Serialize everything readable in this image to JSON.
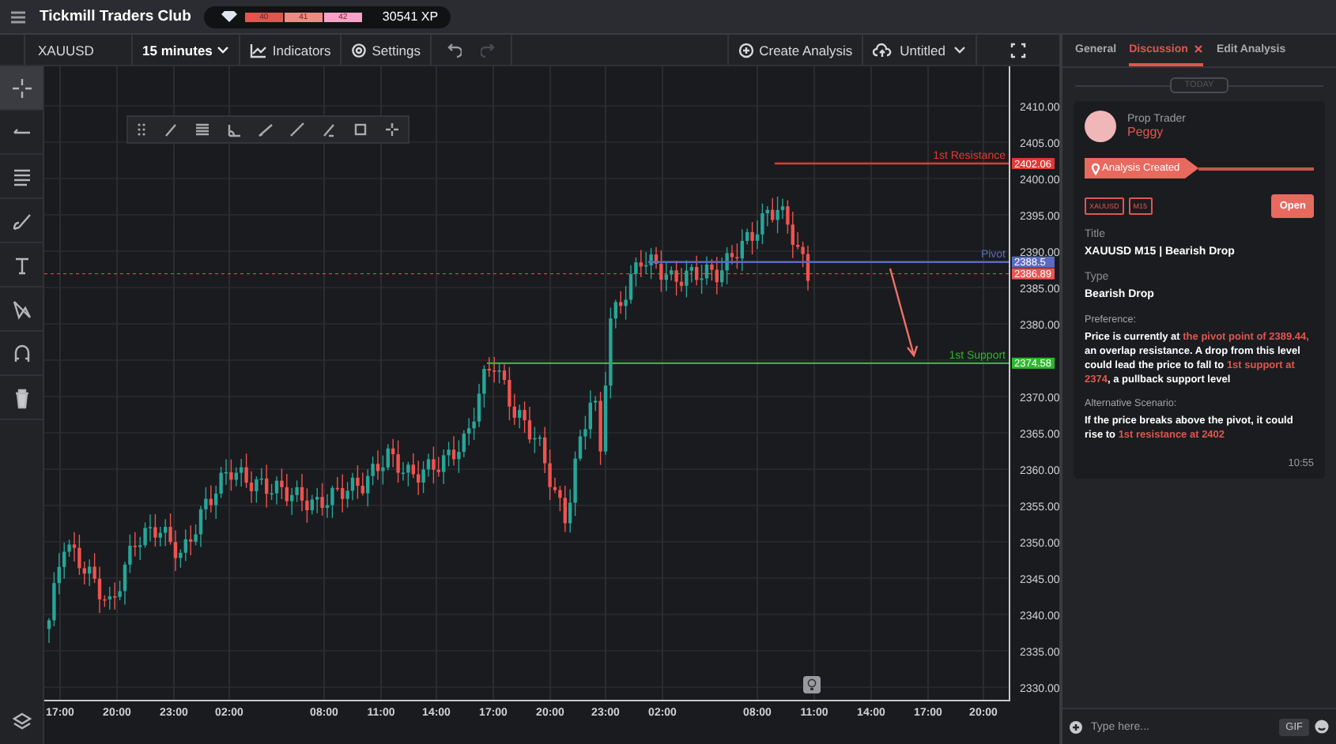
{
  "app": {
    "title": "Tickmill Traders Club",
    "levels": [
      {
        "label": "40",
        "color": "#e0564f"
      },
      {
        "label": "41",
        "color": "#f28a84"
      },
      {
        "label": "42",
        "color": "#f5a3c7"
      }
    ],
    "xp": "30541 XP"
  },
  "toolbar": {
    "symbol": "XAUUSD",
    "interval": "15 minutes",
    "indicators": "Indicators",
    "settings": "Settings",
    "redo_disabled": true,
    "create": "Create Analysis",
    "layout": "Untitled"
  },
  "tools": [
    {
      "kind": "crosshair",
      "selected": true
    },
    {
      "kind": "line",
      "selected": false
    },
    {
      "kind": "fib",
      "selected": false
    },
    {
      "kind": "brush",
      "selected": false
    },
    {
      "kind": "text",
      "selected": false
    },
    {
      "kind": "pattern",
      "selected": false
    },
    {
      "kind": "magnet",
      "selected": false
    },
    {
      "kind": "trash",
      "selected": false
    }
  ],
  "chart": {
    "price_labels": [
      "2410.00",
      "2405.00",
      "2400.00",
      "2395.00",
      "2390.00",
      "2385.00",
      "2380.00",
      "2370.00",
      "2365.00",
      "2360.00",
      "2355.00",
      "2350.00",
      "2345.00",
      "2340.00",
      "2335.00",
      "2330.00"
    ],
    "time_labels": [
      "17:00",
      "20:00",
      "23:00",
      "02:00",
      "08:00",
      "11:00",
      "14:00",
      "17:00",
      "20:00",
      "23:00",
      "02:00",
      "08:00",
      "11:00",
      "14:00",
      "17:00",
      "20:00"
    ],
    "levels": [
      {
        "kind": "resistance",
        "label": "1st Resistance",
        "price": "2402.06",
        "color": "#e53935"
      },
      {
        "kind": "pivot",
        "label": "Pivot",
        "price": "2388.5",
        "color": "#5c6bc0"
      },
      {
        "kind": "current",
        "price": "2386.89",
        "color": "#ef5350"
      },
      {
        "kind": "support",
        "label": "1st Support",
        "price": "2374.58",
        "color": "#2eb82e"
      }
    ]
  },
  "panel": {
    "tabs": [
      {
        "label": "General",
        "selected": false
      },
      {
        "label": "Discussion",
        "selected": true
      },
      {
        "label": "Edit Analysis",
        "selected": false
      }
    ],
    "date_divider": "TODAY",
    "message": {
      "role": "Prop Trader",
      "author": "Peggy",
      "event": "Analysis Created",
      "tags": [
        "XAUUSD",
        "M15"
      ],
      "open": "Open",
      "fields": [
        {
          "kind": "field",
          "label": "Title",
          "value": "XAUUSD M15 | Bearish Drop"
        },
        {
          "kind": "field",
          "label": "Type",
          "value": "Bearish Drop"
        },
        {
          "kind": "note",
          "label": "Preference:",
          "value": "Price is currently at **the pivot point of 2389.44,** an overlap resistance. A drop from this level could lead the price to fall to **1st support at 2374**, a pullback support level"
        },
        {
          "kind": "note",
          "label": "Alternative Scenario:",
          "value": "If the price breaks above the pivot, it could rise to **1st resistance at 2402**"
        }
      ],
      "time": "10:55"
    },
    "composer": {
      "placeholder": "Type here...",
      "gif": "GIF"
    }
  }
}
